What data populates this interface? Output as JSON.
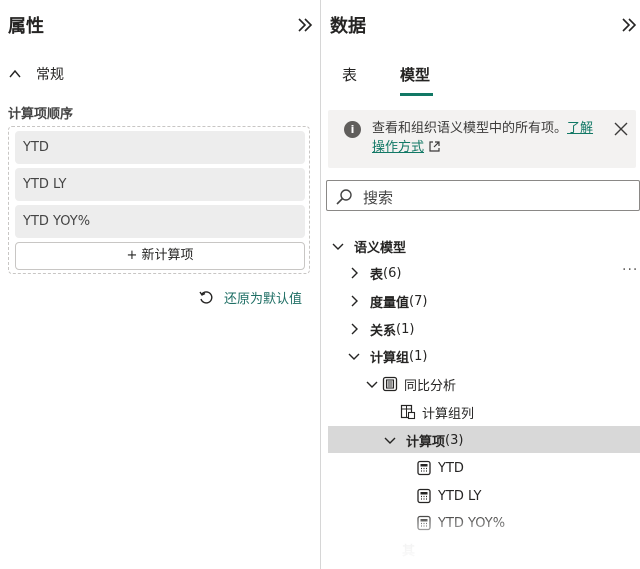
{
  "properties_panel": {
    "title": "属性",
    "section_general": "常规",
    "calc_order_title": "计算项顺序",
    "calc_items": [
      "YTD",
      "YTD LY",
      "YTD YOY%"
    ],
    "new_calc_label": "+ 新计算项",
    "reset_label": "还原为默认值"
  },
  "data_panel": {
    "title": "数据",
    "tabs": [
      "表",
      "模型"
    ],
    "active_tab": "模型",
    "info": {
      "text": "查看和组织语义模型中的所有项。",
      "link": "了解操作方式"
    },
    "search_placeholder": "搜索",
    "tree": {
      "root": "语义模型",
      "tables": "表",
      "tables_count": "(6)",
      "measures": "度量值",
      "measures_count": "(7)",
      "relationships": "关系",
      "relationships_count": "(1)",
      "calc_groups": "计算组",
      "calc_groups_count": "(1)",
      "calc_group_name": "同比分析",
      "calc_group_column": "计算组列",
      "calc_items_label": "计算项",
      "calc_items_count": "(3)",
      "calc_items": [
        "YTD",
        "YTD LY",
        "YTD YOY%"
      ],
      "partial": "其"
    }
  },
  "colors": {
    "accent": "#117865",
    "selected_row": "#d8d8d8",
    "info_bg": "#f3f2f1"
  },
  "icons": [
    "chevron-double-right-icon",
    "chevron-up-icon",
    "reset-icon",
    "info-icon",
    "close-icon",
    "external-link-icon",
    "search-icon",
    "chevron-right-icon",
    "chevron-down-icon",
    "calc-group-icon",
    "calc-column-icon",
    "calc-item-icon",
    "more-options-icon"
  ]
}
